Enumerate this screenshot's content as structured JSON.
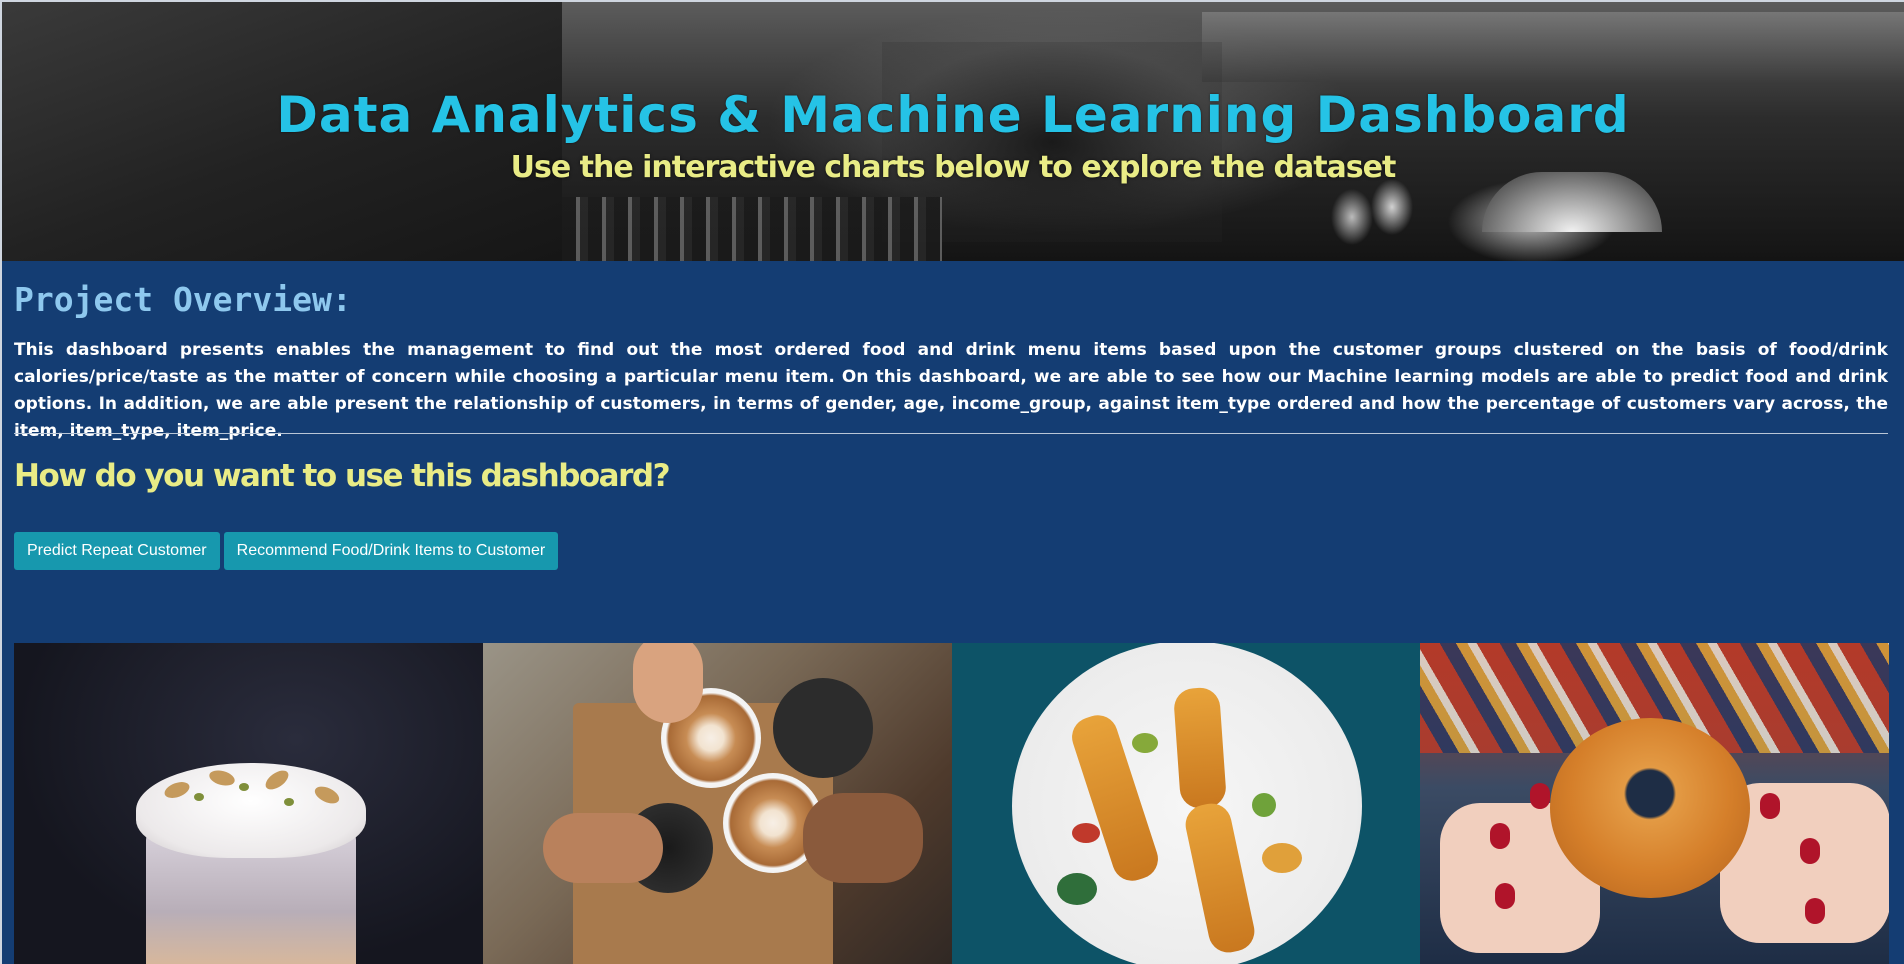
{
  "hero": {
    "title": "Data Analytics & Machine Learning Dashboard",
    "subtitle": "Use the interactive charts below to explore the dataset",
    "background": "cafe-interior-photo"
  },
  "overview": {
    "heading": "Project Overview:",
    "text": "This dashboard presents enables the management to find out the most ordered food and drink menu items based upon the customer groups clustered on the basis of food/drink calories/price/taste as the matter of concern while choosing a particular menu item. On this dashboard, we are able to see how our Machine learning models are able to predict food and drink options. In addition, we are able present the relationship of customers, in terms of gender, age, income_group, against item_type ordered and how the percentage of customers vary across, the item, item_type, item_price."
  },
  "usage": {
    "heading": "How do you want to use this dashboard?",
    "buttons": [
      {
        "label": "Predict Repeat Customer"
      },
      {
        "label": "Recommend Food/Drink Items to Customer"
      }
    ]
  },
  "gallery": {
    "images": [
      {
        "name": "dessert-cup-photo"
      },
      {
        "name": "coffee-cheers-photo"
      },
      {
        "name": "chicken-skewers-plate-photo"
      },
      {
        "name": "donut-hands-photo"
      }
    ]
  },
  "colors": {
    "page_background": "#143d73",
    "title": "#25c3e6",
    "subtitle": "#e9ec86",
    "overview_heading": "#8ec8ee",
    "button": "#1798ae"
  }
}
